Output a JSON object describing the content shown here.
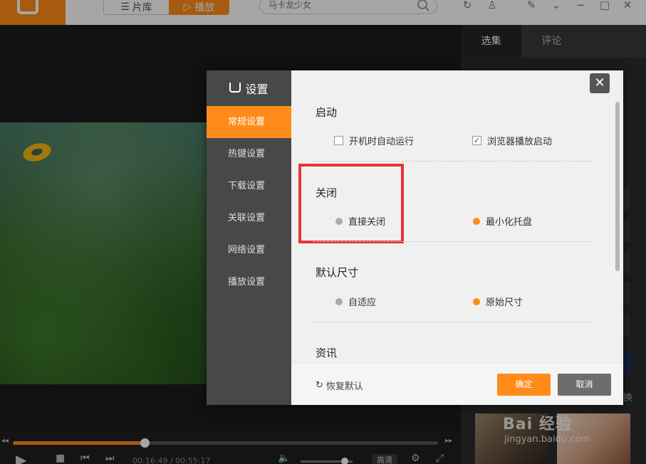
{
  "app": {
    "library_label": "片库",
    "play_label": "播放",
    "search_placeholder": "马卡龙少女"
  },
  "player": {
    "current_time": "00:16:49",
    "separator": " / ",
    "total_time": "00:55:17",
    "quality_label": "高清",
    "progress": 0.31,
    "volume": 0.85
  },
  "right_panel": {
    "tabs": [
      "选集",
      "评论"
    ],
    "switch_label": "换"
  },
  "watermark": {
    "text": "Bai 经验",
    "url": "jingyan.baidu.com"
  },
  "settings": {
    "title": "设置",
    "nav": [
      "常规设置",
      "热键设置",
      "下载设置",
      "关联设置",
      "网络设置",
      "播放设置"
    ],
    "active_nav": 0,
    "sections": {
      "startup": {
        "title": "启动",
        "options": [
          {
            "label": "开机时自动运行",
            "checked": false
          },
          {
            "label": "浏览器播放启动",
            "checked": true
          }
        ]
      },
      "close": {
        "title": "关闭",
        "options": [
          {
            "label": "直接关闭",
            "selected": false
          },
          {
            "label": "最小化托盘",
            "selected": true
          }
        ]
      },
      "size": {
        "title": "默认尺寸",
        "options": [
          {
            "label": "自适应",
            "selected": false
          },
          {
            "label": "原始尺寸",
            "selected": true
          }
        ]
      },
      "news": {
        "title": "资讯"
      }
    },
    "restore_label": "恢复默认",
    "ok_label": "确定",
    "cancel_label": "取消"
  },
  "colors": {
    "accent": "#ff8c1a",
    "highlight": "#e8333a"
  }
}
